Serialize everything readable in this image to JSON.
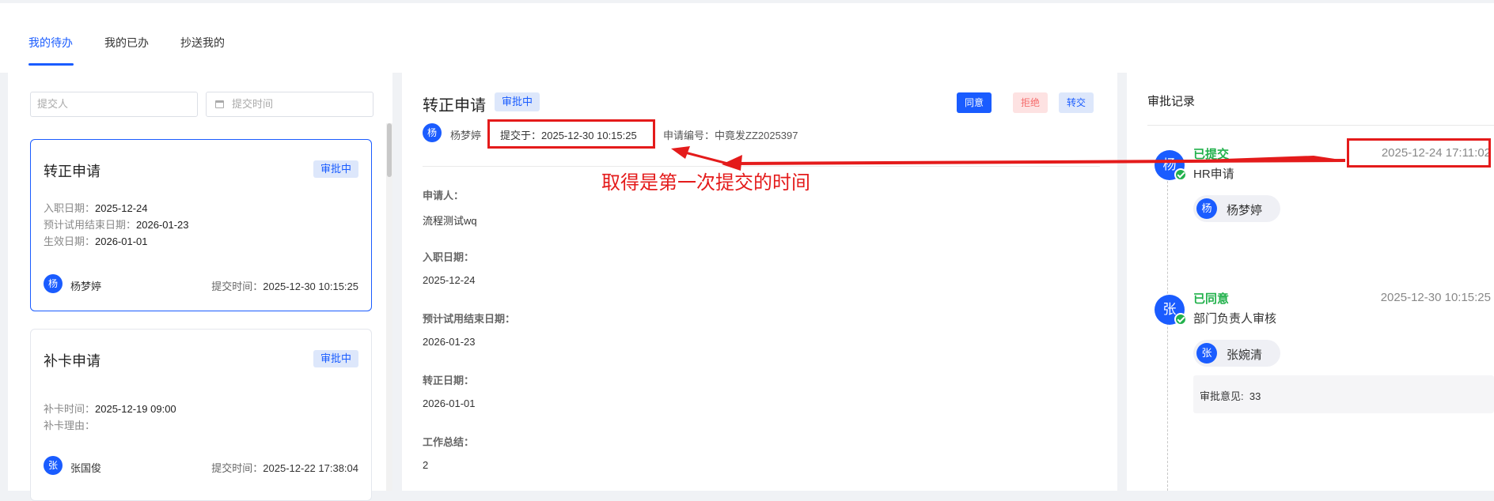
{
  "tabs": [
    {
      "label": "我的待办",
      "active": true
    },
    {
      "label": "我的已办",
      "active": false
    },
    {
      "label": "抄送我的",
      "active": false
    }
  ],
  "filters": {
    "submitter_placeholder": "提交人",
    "time_placeholder": "提交时间"
  },
  "cards": [
    {
      "title": "转正申请",
      "status": "审批中",
      "fields": [
        {
          "label": "入职日期：",
          "value": "2025-12-24"
        },
        {
          "label": "预计试用结束日期：",
          "value": "2026-01-23"
        },
        {
          "label": "生效日期：",
          "value": "2026-01-01"
        }
      ],
      "avatar": "杨",
      "user": "杨梦婷",
      "submit_label": "提交时间：",
      "submit_time": "2025-12-30 10:15:25"
    },
    {
      "title": "补卡申请",
      "status": "审批中",
      "fields": [
        {
          "label": "补卡时间：",
          "value": "2025-12-19 09:00"
        },
        {
          "label": "补卡理由：",
          "value": ""
        }
      ],
      "avatar": "张",
      "user": "张国俊",
      "submit_label": "提交时间：",
      "submit_time": "2025-12-22 17:38:04"
    }
  ],
  "detail": {
    "title": "转正申请",
    "status": "审批中",
    "buttons": {
      "agree": "同意",
      "reject": "拒绝",
      "transfer": "转交"
    },
    "avatar": "杨",
    "user": "杨梦婷",
    "submitted_text": "提交于：2025-12-30 10:15:25",
    "request_no": "申请编号：中竟发ZZ2025397",
    "fields": [
      {
        "label": "申请人：",
        "value": "流程测试wq"
      },
      {
        "label": "入职日期：",
        "value": "2025-12-24"
      },
      {
        "label": "预计试用结束日期：",
        "value": "2026-01-23"
      },
      {
        "label": "转正日期：",
        "value": "2026-01-01"
      },
      {
        "label": "工作总结：",
        "value": "2"
      }
    ]
  },
  "record": {
    "title": "审批记录",
    "items": [
      {
        "avatar": "杨",
        "status": "已提交",
        "time": "2025-12-24 17:11:02",
        "node": "HR申请",
        "person_avatar": "杨",
        "person": "杨梦婷"
      },
      {
        "avatar": "张",
        "status": "已同意",
        "time": "2025-12-30 10:15:25",
        "node": "部门负责人审核",
        "person_avatar": "张",
        "person": "张婉清",
        "opinion_label": "审批意见:",
        "opinion": "33"
      }
    ]
  },
  "annotation": {
    "text": "取得是第一次提交的时间",
    "color": "#e41b1b"
  },
  "colors": {
    "accent": "#1a5cff",
    "success": "#22b14c",
    "danger": "#f56c6c"
  }
}
